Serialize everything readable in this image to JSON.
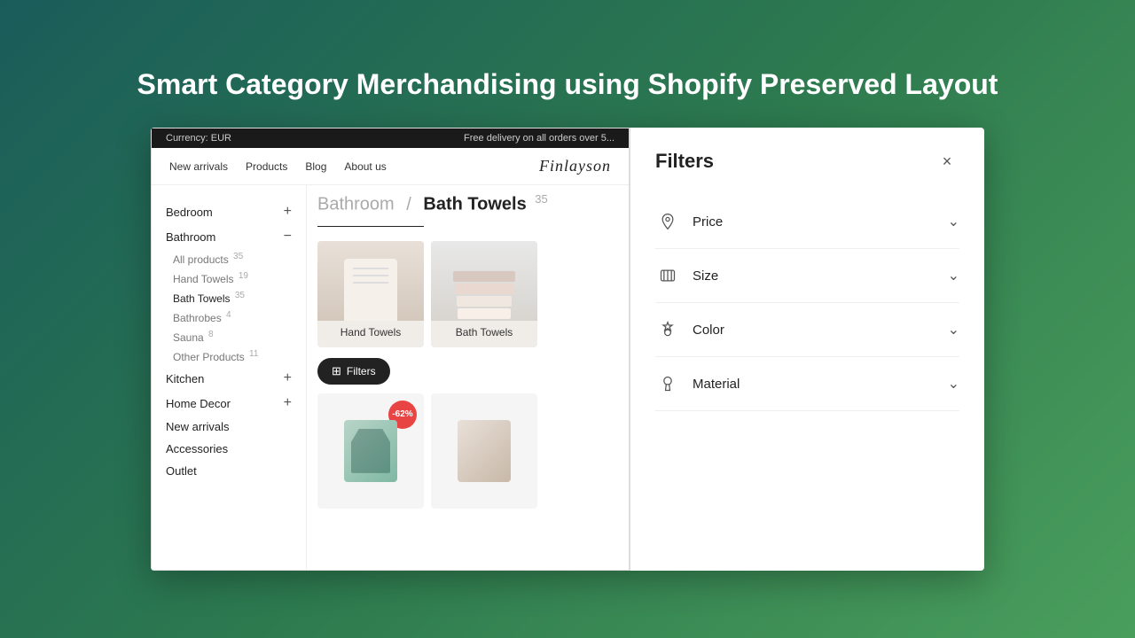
{
  "page": {
    "title": "Smart Category Merchandising using Shopify Preserved Layout"
  },
  "store": {
    "topbar": {
      "currency": "Currency: EUR",
      "promo": "Free delivery on all orders over 5..."
    },
    "nav": {
      "links": [
        "New arrivals",
        "Products",
        "Blog",
        "About us"
      ],
      "logo": "Finlayson"
    },
    "breadcrumb": {
      "parent": "Bathroom",
      "separator": "/",
      "current": "Bath Towels",
      "count": "35"
    },
    "sidebar": {
      "categories": [
        {
          "label": "Bedroom",
          "expanded": false,
          "symbol": "+"
        },
        {
          "label": "Bathroom",
          "expanded": true,
          "symbol": "−",
          "subcategories": [
            {
              "label": "All products",
              "count": "35",
              "active": false
            },
            {
              "label": "Hand Towels",
              "count": "19",
              "active": false
            },
            {
              "label": "Bath Towels",
              "count": "35",
              "active": true
            },
            {
              "label": "Bathrobes",
              "count": "4",
              "active": false
            },
            {
              "label": "Sauna",
              "count": "8",
              "active": false
            },
            {
              "label": "Other Products",
              "count": "11",
              "active": false
            }
          ]
        },
        {
          "label": "Kitchen",
          "expanded": false,
          "symbol": "+"
        },
        {
          "label": "Home Decor",
          "expanded": false,
          "symbol": "+"
        },
        {
          "label": "New arrivals",
          "expanded": false,
          "symbol": ""
        },
        {
          "label": "Accessories",
          "expanded": false,
          "symbol": ""
        },
        {
          "label": "Outlet",
          "expanded": false,
          "symbol": ""
        }
      ]
    },
    "category_cards": [
      {
        "label": "Hand Towels"
      },
      {
        "label": "Bath Towels"
      }
    ],
    "filters_button": {
      "label": "Filters",
      "icon": "⊞"
    },
    "products": [
      {
        "discount": "-62%",
        "has_image": true
      }
    ]
  },
  "filters": {
    "title": "Filters",
    "close_label": "×",
    "items": [
      {
        "label": "Price",
        "icon": "price"
      },
      {
        "label": "Size",
        "icon": "size"
      },
      {
        "label": "Color",
        "icon": "color"
      },
      {
        "label": "Material",
        "icon": "material"
      }
    ]
  }
}
